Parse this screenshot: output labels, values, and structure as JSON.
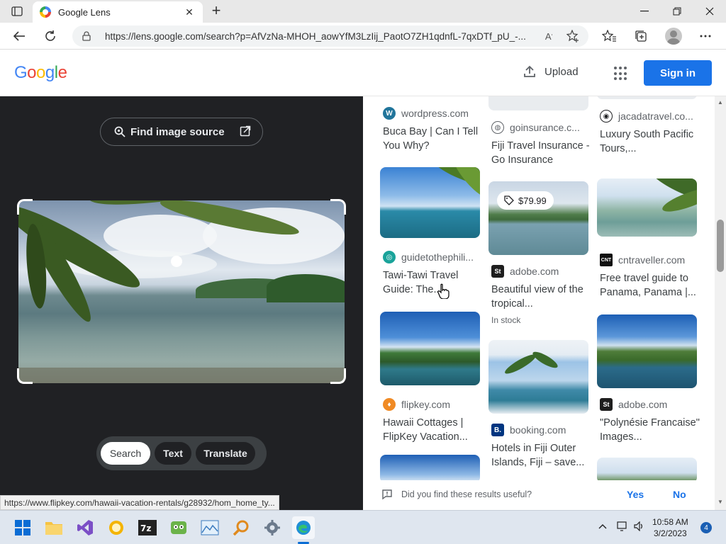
{
  "browser": {
    "tab_title": "Google Lens",
    "url": "https://lens.google.com/search?p=AfVzNa-MHOH_aowYfM3LzIij_PaotO7ZH1qdnfL-7qxDTf_pU_-...",
    "status_url": "https://www.flipkey.com/hawaii-vacation-rentals/g28932/hom_home_ty..."
  },
  "header": {
    "logo": "Google",
    "upload_label": "Upload",
    "signin_label": "Sign in"
  },
  "lens": {
    "find_source_label": "Find image source",
    "modes": [
      "Search",
      "Text",
      "Translate"
    ],
    "active_mode": "Search"
  },
  "results": {
    "col1": [
      {
        "source": "wordpress.com",
        "title": "Buca Bay | Can I Tell You Why?"
      },
      {
        "source": "guidetothephili...",
        "title": "Tawi-Tawi Travel Guide: The..."
      },
      {
        "source": "flipkey.com",
        "title": "Hawaii Cottages | FlipKey Vacation..."
      }
    ],
    "col2": [
      {
        "source": "goinsurance.c...",
        "title": "Fiji Travel Insurance - Go Insurance"
      },
      {
        "source": "adobe.com",
        "title": "Beautiful view of the tropical...",
        "price": "$79.99",
        "stock": "In stock"
      },
      {
        "source": "booking.com",
        "title": "Hotels in Fiji Outer Islands, Fiji – save..."
      }
    ],
    "col3": [
      {
        "source": "jacadatravel.co...",
        "title": "Luxury South Pacific Tours,..."
      },
      {
        "source": "cntraveller.com",
        "title": "Free travel guide to Panama, Panama |..."
      },
      {
        "source": "adobe.com",
        "title": "\"Polynésie Francaise\" Images..."
      }
    ]
  },
  "feedback": {
    "question": "Did you find these results useful?",
    "yes": "Yes",
    "no": "No"
  },
  "taskbar": {
    "time": "10:58 AM",
    "date": "3/2/2023",
    "notifications": "4"
  },
  "colors": {
    "accent": "#1a73e8",
    "dark_panel": "#202124"
  }
}
